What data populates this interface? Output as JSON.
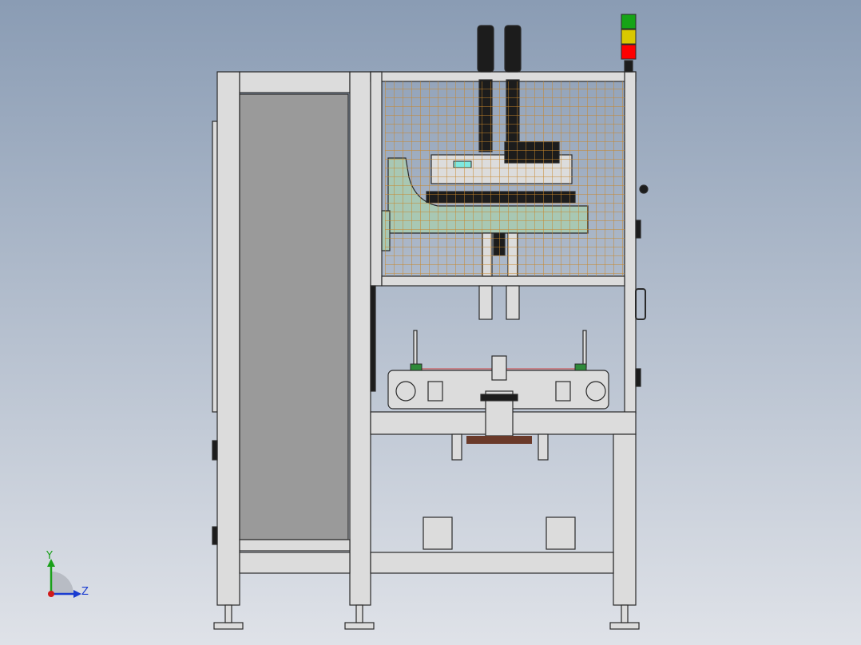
{
  "viewport": {
    "background_top": "#8a9cb4",
    "background_bottom": "#dfe2e8"
  },
  "colors": {
    "frame_fill": "#dcdcdc",
    "frame_edge": "#2a2a2a",
    "panel_gray": "#9a9a9a",
    "mesh_line": "#c8862a",
    "base_plate": "#a8c8b4",
    "dark_part": "#1c1c1c",
    "light_red": "#ff0000",
    "light_yellow": "#d8c800",
    "light_green": "#16a416",
    "brown_block": "#6a3a2a",
    "axis_y": "#1aa01a",
    "axis_z": "#1a3cd0",
    "axis_origin": "#d01a1a"
  },
  "signal_tower": {
    "lights": [
      "green",
      "yellow",
      "red"
    ]
  },
  "triad": {
    "y_label": "Y",
    "z_label": "Z"
  }
}
